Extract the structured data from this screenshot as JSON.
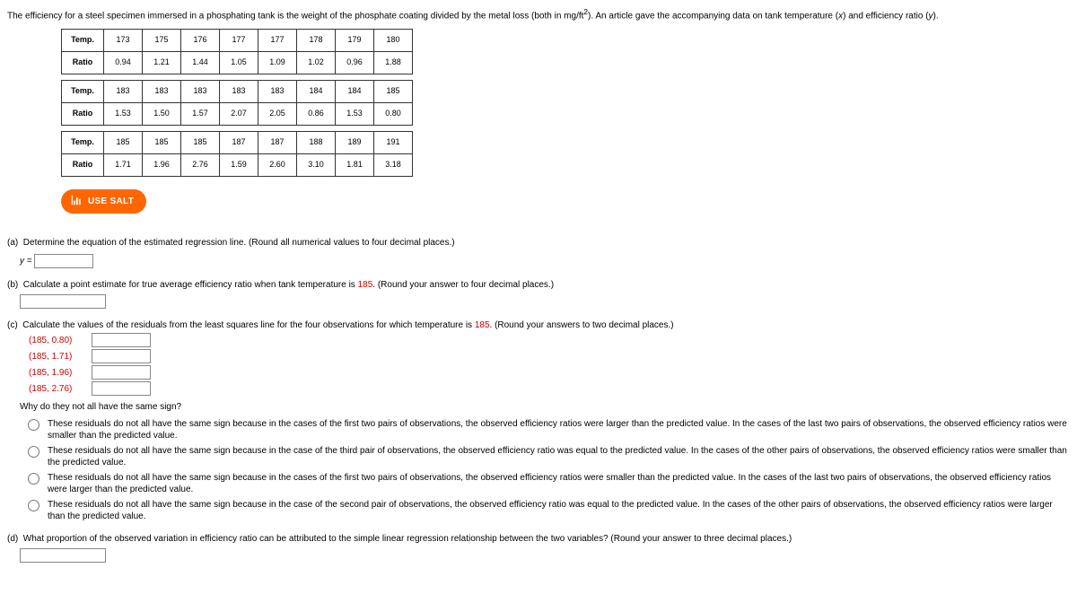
{
  "intro": {
    "t1": "The efficiency for a steel specimen immersed in a phosphating tank is the weight of the phosphate coating divided by the metal loss (both in mg/ft",
    "sup1": "2",
    "t2": "). An article gave the accompanying data on tank temperature (",
    "xvar": "x",
    "t3": ") and efficiency ratio (",
    "yvar": "y",
    "t4": ")."
  },
  "row_temp_label": "Temp.",
  "row_ratio_label": "Ratio",
  "table1": {
    "temp": [
      "173",
      "175",
      "176",
      "177",
      "177",
      "178",
      "179",
      "180"
    ],
    "ratio": [
      "0.94",
      "1.21",
      "1.44",
      "1.05",
      "1.09",
      "1.02",
      "0.96",
      "1.88"
    ]
  },
  "table2": {
    "temp": [
      "183",
      "183",
      "183",
      "183",
      "183",
      "184",
      "184",
      "185"
    ],
    "ratio": [
      "1.53",
      "1.50",
      "1.57",
      "2.07",
      "2.05",
      "0.86",
      "1.53",
      "0.80"
    ]
  },
  "table3": {
    "temp": [
      "185",
      "185",
      "185",
      "187",
      "187",
      "188",
      "189",
      "191"
    ],
    "ratio": [
      "1.71",
      "1.96",
      "2.76",
      "1.59",
      "2.60",
      "3.10",
      "1.81",
      "3.18"
    ]
  },
  "salt_label": "USE SALT",
  "a": {
    "label": "(a)",
    "text": "Determine the equation of the estimated regression line. (Round all numerical values to four decimal places.)",
    "yeq": "y ="
  },
  "b": {
    "label": "(b)",
    "t1": "Calculate a point estimate for true average efficiency ratio when tank temperature is ",
    "val": "185",
    "t2": ". (Round your answer to four decimal places.)"
  },
  "c": {
    "label": "(c)",
    "t1": "Calculate the values of the residuals from the least squares line for the four observations for which temperature is ",
    "val": "185",
    "t2": ". (Round your answers to two decimal places.)",
    "points": [
      "(185, 0.80)",
      "(185, 1.71)",
      "(185, 1.96)",
      "(185, 2.76)"
    ],
    "why": "Why do they not all have the same sign?",
    "opts": [
      "These residuals do not all have the same sign because in the cases of the first two pairs of observations, the observed efficiency ratios were larger than the predicted value. In the cases of the last two pairs of observations, the observed efficiency ratios were smaller than the predicted value.",
      "These residuals do not all have the same sign because in the case of the third pair of observations, the observed efficiency ratio was equal to the predicted value. In the cases of the other pairs of observations, the observed efficiency ratios were smaller than the predicted value.",
      "These residuals do not all have the same sign because in the cases of the first two pairs of observations, the observed efficiency ratios were smaller than the predicted value. In the cases of the last two pairs of observations, the observed efficiency ratios were larger than the predicted value.",
      "These residuals do not all have the same sign because in the case of the second pair of observations, the observed efficiency ratio was equal to the predicted value. In the cases of the other pairs of observations, the observed efficiency ratios were larger than the predicted value."
    ]
  },
  "d": {
    "label": "(d)",
    "text": "What proportion of the observed variation in efficiency ratio can be attributed to the simple linear regression relationship between the two variables? (Round your answer to three decimal places.)"
  }
}
